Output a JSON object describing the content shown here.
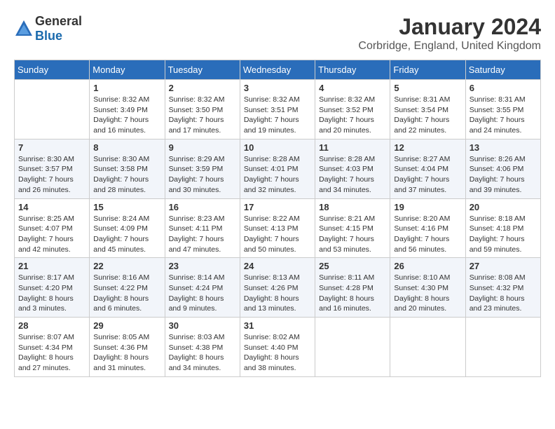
{
  "logo": {
    "general": "General",
    "blue": "Blue"
  },
  "title": "January 2024",
  "location": "Corbridge, England, United Kingdom",
  "weekdays": [
    "Sunday",
    "Monday",
    "Tuesday",
    "Wednesday",
    "Thursday",
    "Friday",
    "Saturday"
  ],
  "weeks": [
    [
      {
        "day": "",
        "sunrise": "",
        "sunset": "",
        "daylight": ""
      },
      {
        "day": "1",
        "sunrise": "Sunrise: 8:32 AM",
        "sunset": "Sunset: 3:49 PM",
        "daylight": "Daylight: 7 hours and 16 minutes."
      },
      {
        "day": "2",
        "sunrise": "Sunrise: 8:32 AM",
        "sunset": "Sunset: 3:50 PM",
        "daylight": "Daylight: 7 hours and 17 minutes."
      },
      {
        "day": "3",
        "sunrise": "Sunrise: 8:32 AM",
        "sunset": "Sunset: 3:51 PM",
        "daylight": "Daylight: 7 hours and 19 minutes."
      },
      {
        "day": "4",
        "sunrise": "Sunrise: 8:32 AM",
        "sunset": "Sunset: 3:52 PM",
        "daylight": "Daylight: 7 hours and 20 minutes."
      },
      {
        "day": "5",
        "sunrise": "Sunrise: 8:31 AM",
        "sunset": "Sunset: 3:54 PM",
        "daylight": "Daylight: 7 hours and 22 minutes."
      },
      {
        "day": "6",
        "sunrise": "Sunrise: 8:31 AM",
        "sunset": "Sunset: 3:55 PM",
        "daylight": "Daylight: 7 hours and 24 minutes."
      }
    ],
    [
      {
        "day": "7",
        "sunrise": "Sunrise: 8:30 AM",
        "sunset": "Sunset: 3:57 PM",
        "daylight": "Daylight: 7 hours and 26 minutes."
      },
      {
        "day": "8",
        "sunrise": "Sunrise: 8:30 AM",
        "sunset": "Sunset: 3:58 PM",
        "daylight": "Daylight: 7 hours and 28 minutes."
      },
      {
        "day": "9",
        "sunrise": "Sunrise: 8:29 AM",
        "sunset": "Sunset: 3:59 PM",
        "daylight": "Daylight: 7 hours and 30 minutes."
      },
      {
        "day": "10",
        "sunrise": "Sunrise: 8:28 AM",
        "sunset": "Sunset: 4:01 PM",
        "daylight": "Daylight: 7 hours and 32 minutes."
      },
      {
        "day": "11",
        "sunrise": "Sunrise: 8:28 AM",
        "sunset": "Sunset: 4:03 PM",
        "daylight": "Daylight: 7 hours and 34 minutes."
      },
      {
        "day": "12",
        "sunrise": "Sunrise: 8:27 AM",
        "sunset": "Sunset: 4:04 PM",
        "daylight": "Daylight: 7 hours and 37 minutes."
      },
      {
        "day": "13",
        "sunrise": "Sunrise: 8:26 AM",
        "sunset": "Sunset: 4:06 PM",
        "daylight": "Daylight: 7 hours and 39 minutes."
      }
    ],
    [
      {
        "day": "14",
        "sunrise": "Sunrise: 8:25 AM",
        "sunset": "Sunset: 4:07 PM",
        "daylight": "Daylight: 7 hours and 42 minutes."
      },
      {
        "day": "15",
        "sunrise": "Sunrise: 8:24 AM",
        "sunset": "Sunset: 4:09 PM",
        "daylight": "Daylight: 7 hours and 45 minutes."
      },
      {
        "day": "16",
        "sunrise": "Sunrise: 8:23 AM",
        "sunset": "Sunset: 4:11 PM",
        "daylight": "Daylight: 7 hours and 47 minutes."
      },
      {
        "day": "17",
        "sunrise": "Sunrise: 8:22 AM",
        "sunset": "Sunset: 4:13 PM",
        "daylight": "Daylight: 7 hours and 50 minutes."
      },
      {
        "day": "18",
        "sunrise": "Sunrise: 8:21 AM",
        "sunset": "Sunset: 4:15 PM",
        "daylight": "Daylight: 7 hours and 53 minutes."
      },
      {
        "day": "19",
        "sunrise": "Sunrise: 8:20 AM",
        "sunset": "Sunset: 4:16 PM",
        "daylight": "Daylight: 7 hours and 56 minutes."
      },
      {
        "day": "20",
        "sunrise": "Sunrise: 8:18 AM",
        "sunset": "Sunset: 4:18 PM",
        "daylight": "Daylight: 7 hours and 59 minutes."
      }
    ],
    [
      {
        "day": "21",
        "sunrise": "Sunrise: 8:17 AM",
        "sunset": "Sunset: 4:20 PM",
        "daylight": "Daylight: 8 hours and 3 minutes."
      },
      {
        "day": "22",
        "sunrise": "Sunrise: 8:16 AM",
        "sunset": "Sunset: 4:22 PM",
        "daylight": "Daylight: 8 hours and 6 minutes."
      },
      {
        "day": "23",
        "sunrise": "Sunrise: 8:14 AM",
        "sunset": "Sunset: 4:24 PM",
        "daylight": "Daylight: 8 hours and 9 minutes."
      },
      {
        "day": "24",
        "sunrise": "Sunrise: 8:13 AM",
        "sunset": "Sunset: 4:26 PM",
        "daylight": "Daylight: 8 hours and 13 minutes."
      },
      {
        "day": "25",
        "sunrise": "Sunrise: 8:11 AM",
        "sunset": "Sunset: 4:28 PM",
        "daylight": "Daylight: 8 hours and 16 minutes."
      },
      {
        "day": "26",
        "sunrise": "Sunrise: 8:10 AM",
        "sunset": "Sunset: 4:30 PM",
        "daylight": "Daylight: 8 hours and 20 minutes."
      },
      {
        "day": "27",
        "sunrise": "Sunrise: 8:08 AM",
        "sunset": "Sunset: 4:32 PM",
        "daylight": "Daylight: 8 hours and 23 minutes."
      }
    ],
    [
      {
        "day": "28",
        "sunrise": "Sunrise: 8:07 AM",
        "sunset": "Sunset: 4:34 PM",
        "daylight": "Daylight: 8 hours and 27 minutes."
      },
      {
        "day": "29",
        "sunrise": "Sunrise: 8:05 AM",
        "sunset": "Sunset: 4:36 PM",
        "daylight": "Daylight: 8 hours and 31 minutes."
      },
      {
        "day": "30",
        "sunrise": "Sunrise: 8:03 AM",
        "sunset": "Sunset: 4:38 PM",
        "daylight": "Daylight: 8 hours and 34 minutes."
      },
      {
        "day": "31",
        "sunrise": "Sunrise: 8:02 AM",
        "sunset": "Sunset: 4:40 PM",
        "daylight": "Daylight: 8 hours and 38 minutes."
      },
      {
        "day": "",
        "sunrise": "",
        "sunset": "",
        "daylight": ""
      },
      {
        "day": "",
        "sunrise": "",
        "sunset": "",
        "daylight": ""
      },
      {
        "day": "",
        "sunrise": "",
        "sunset": "",
        "daylight": ""
      }
    ]
  ]
}
